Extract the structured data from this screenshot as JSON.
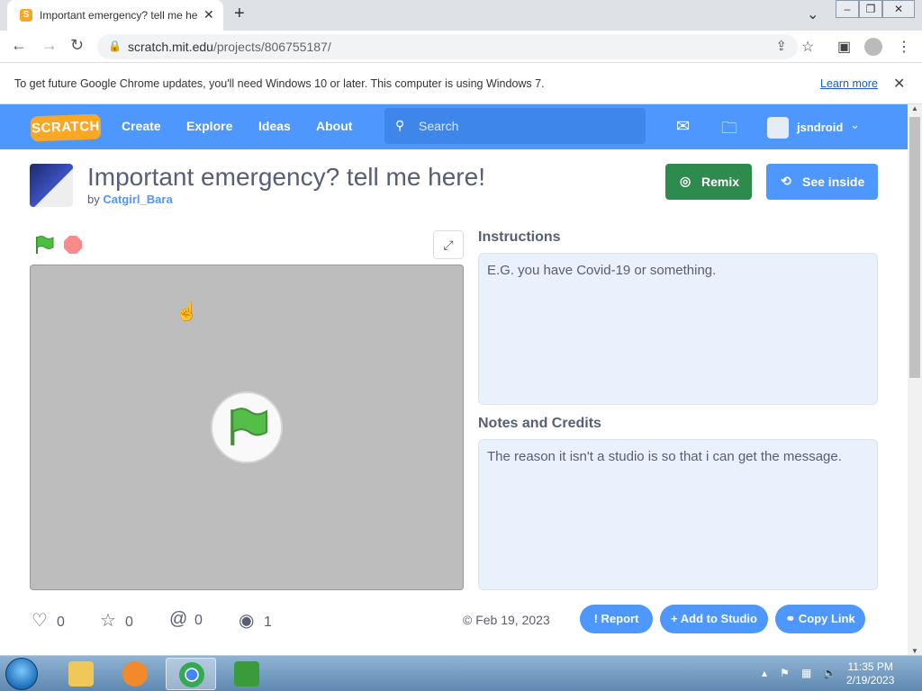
{
  "browser": {
    "tab_title": "Important emergency? tell me he",
    "url_host": "scratch.mit.edu",
    "url_path": "/projects/806755187/",
    "infobar_message": "To get future Google Chrome updates, you'll need Windows 10 or later. This computer is using Windows 7.",
    "infobar_link": "Learn more"
  },
  "scratch_nav": {
    "logo": "SCRATCH",
    "links": [
      "Create",
      "Explore",
      "Ideas",
      "About"
    ],
    "search_placeholder": "Search",
    "username": "jsndroid"
  },
  "project": {
    "title": "Important emergency? tell me here!",
    "by_label": "by",
    "author": "Catgirl_Bara",
    "remix_label": "Remix",
    "see_inside_label": "See inside",
    "instructions_heading": "Instructions",
    "instructions_text": "E.G. you have Covid-19 or something.",
    "notes_heading": "Notes and Credits",
    "notes_text": "The reason it isn't a studio is so that i can get the message.",
    "stats": {
      "loves": "0",
      "favorites": "0",
      "remixes": "0",
      "views": "1"
    },
    "date": "Feb 19, 2023",
    "report_label": "Report",
    "add_to_studio_label": "Add to Studio",
    "copy_link_label": "Copy Link"
  },
  "taskbar": {
    "time": "11:35 PM",
    "date": "2/19/2023"
  },
  "colors": {
    "scratch_blue": "#4d97ff",
    "remix_green": "#2e8b4e",
    "stage_gray": "#bdbdbd"
  }
}
